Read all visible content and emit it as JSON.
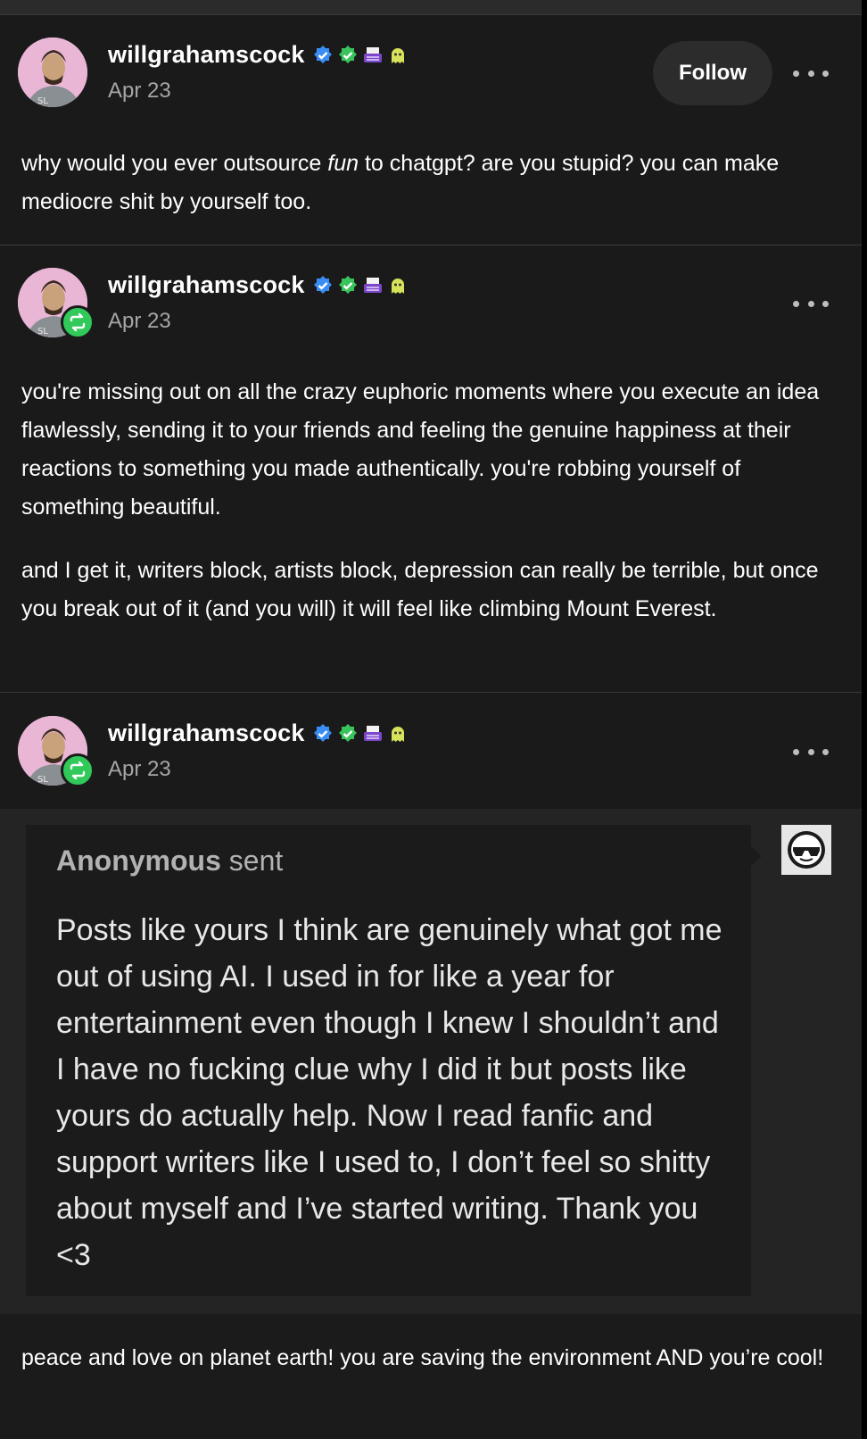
{
  "posts": [
    {
      "username": "willgrahamscock",
      "date": "Apr 23",
      "follow_label": "Follow",
      "body": [
        "why would you ever outsource ",
        "fun",
        " to chatgpt? are you stupid? you can make mediocre shit by yourself too."
      ]
    },
    {
      "username": "willgrahamscock",
      "date": "Apr 23",
      "paragraphs": [
        "you're missing out on all the crazy euphoric moments where you execute an idea flawlessly, sending it to your friends and feeling the genuine happiness at their reactions to something you made authentically. you're robbing yourself of something beautiful.",
        "and I get it, writers block, artists block, depression can really be terrible, but once you break out of it (and you will) it will feel like climbing Mount Everest."
      ]
    },
    {
      "username": "willgrahamscock",
      "date": "Apr 23",
      "ask": {
        "sender": "Anonymous",
        "sent_label": " sent",
        "body": "Posts like yours I think are genuinely what got me out of using AI. I used in for like a year for entertainment even though I knew I shouldn’t and I have no fucking clue why I did it but posts like yours do actually help. Now I read fanfic and support writers like I used to, I don’t feel so shitty about myself and I’ve started writing. Thank you <3"
      },
      "reply": "peace and love on planet earth! you are saving the environment AND you’re cool!"
    }
  ],
  "icons": {
    "verified_blue": "verified-blue-badge-icon",
    "verified_green": "verified-green-badge-icon",
    "typewriter": "typewriter-badge-icon",
    "ghost": "ghost-badge-icon",
    "reblog": "reblog-icon",
    "more": "more-options-icon",
    "anon": "anonymous-sunglasses-icon"
  },
  "colors": {
    "background": "#1a1a1a",
    "reblog_green": "#31c95a",
    "verified_blue": "#3a8df5",
    "verified_green": "#39c35c",
    "muted": "#a6a6a6"
  }
}
